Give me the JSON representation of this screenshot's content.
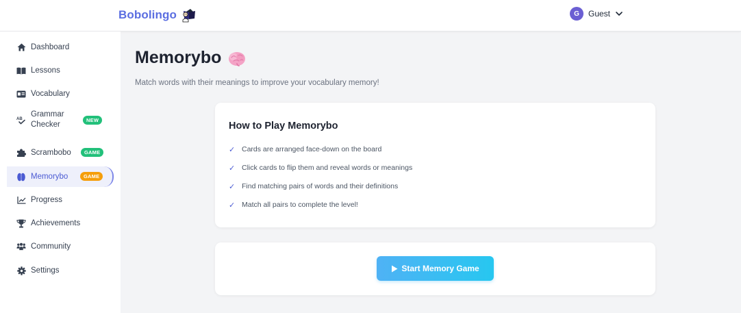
{
  "header": {
    "brand": "Bobolingo",
    "brand_logo_icon": "reading-character-logo",
    "user": {
      "initial": "G",
      "name": "Guest"
    }
  },
  "sidebar": {
    "items": [
      {
        "label": "Dashboard",
        "icon": "home-icon"
      },
      {
        "label": "Lessons",
        "icon": "book-icon"
      },
      {
        "label": "Vocabulary",
        "icon": "id-card-icon"
      },
      {
        "label": "Grammar\nChecker",
        "icon": "spellcheck-icon",
        "badge": "NEW"
      },
      {
        "label": "Scrambobo",
        "icon": "puzzle-icon",
        "badge": "GAME"
      },
      {
        "label": "Memorybo",
        "icon": "brain-icon",
        "badge": "GAME",
        "active": true
      },
      {
        "label": "Progress",
        "icon": "chart-line-icon"
      },
      {
        "label": "Achievements",
        "icon": "trophy-icon"
      },
      {
        "label": "Community",
        "icon": "users-icon"
      },
      {
        "label": "Settings",
        "icon": "gear-icon"
      }
    ]
  },
  "page": {
    "title": "Memorybo",
    "title_icon": "brain-emoji-icon",
    "subtitle": "Match words with their meanings to improve your vocabulary memory!"
  },
  "howto": {
    "title": "How to Play Memorybo",
    "check_glyph": "✓",
    "rules": [
      "Cards are arranged face-down on the board",
      "Click cards to flip them and reveal words or meanings",
      "Find matching pairs of words and their definitions",
      "Match all pairs to complete the level!"
    ]
  },
  "start": {
    "label": "Start Memory Game",
    "icon": "play-icon"
  },
  "colors": {
    "brand": "#5b6ee1",
    "active_nav": "#4b5bd3",
    "badge_new": "#22c07a",
    "badge_game": "#22c07a",
    "badge_game_active": "#f59e0b",
    "button_gradient_start": "#4fb2f5",
    "button_gradient_end": "#27c7f0"
  }
}
